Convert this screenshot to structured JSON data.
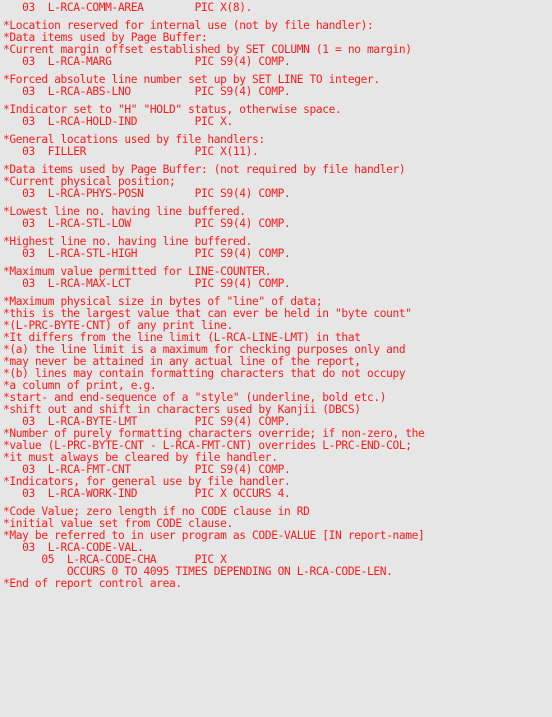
{
  "document": {
    "text_color": "#ff1a1a",
    "background_color": "#e6e6e6",
    "blocks": [
      [
        "   03  L-RCA-COMM-AREA        PIC X(8)."
      ],
      [
        "*Location reserved for internal use (not by file handler):",
        "*Data items used by Page Buffer:",
        "*Current margin offset established by SET COLUMN (1 = no margin)",
        "   03  L-RCA-MARG             PIC S9(4) COMP."
      ],
      [
        "*Forced absolute line number set up by SET LINE TO integer.",
        "   03  L-RCA-ABS-LNO          PIC S9(4) COMP."
      ],
      [
        "*Indicator set to \"H\" \"HOLD\" status, otherwise space.",
        "   03  L-RCA-HOLD-IND         PIC X."
      ],
      [
        "*General locations used by file handlers:",
        "   03  FILLER                 PIC X(11)."
      ],
      [
        "*Data items used by Page Buffer: (not required by file handler)",
        "*Current physical position;",
        "   03  L-RCA-PHYS-POSN        PIC S9(4) COMP."
      ],
      [
        "*Lowest line no. having line buffered.",
        "   03  L-RCA-STL-LOW          PIC S9(4) COMP."
      ],
      [
        "*Highest line no. having line buffered.",
        "   03  L-RCA-STL-HIGH         PIC S9(4) COMP."
      ],
      [
        "*Maximum value permitted for LINE-COUNTER.",
        "   03  L-RCA-MAX-LCT          PIC S9(4) COMP."
      ],
      [
        "*Maximum physical size in bytes of \"line\" of data;",
        "*this is the largest value that can ever be held in \"byte count\"",
        "*(L-PRC-BYTE-CNT) of any print line.",
        "*It differs from the line limit (L-RCA-LINE-LMT) in that",
        "*(a) the line limit is a maximum for checking purposes only and",
        "*may never be attained in any actual line of the report,",
        "*(b) lines may contain formatting characters that do not occupy",
        "*a column of print, e.g.",
        "*start- and end-sequence of a \"style\" (underline, bold etc.)",
        "*shift out and shift in characters used by Kanjii (DBCS)",
        "   03  L-RCA-BYTE-LMT         PIC S9(4) COMP.",
        "*Number of purely formatting characters override; if non-zero, the",
        "*value (L-PRC-BYTE-CNT - L-RCA-FMT-CNT) overrides L-PRC-END-COL;",
        "*it must always be cleared by file handler.",
        "   03  L-RCA-FMT-CNT          PIC S9(4) COMP.",
        "*Indicators, for general use by file handler.",
        "   03  L-RCA-WORK-IND         PIC X OCCURS 4."
      ],
      [
        "*Code Value; zero length if no CODE clause in RD",
        "*initial value set from CODE clause.",
        "*May be referred to in user program as CODE-VALUE [IN report-name]",
        "   03  L-RCA-CODE-VAL.",
        "      05  L-RCA-CODE-CHA      PIC X",
        "          OCCURS 0 TO 4095 TIMES DEPENDING ON L-RCA-CODE-LEN.",
        "*End of report control area."
      ]
    ]
  }
}
